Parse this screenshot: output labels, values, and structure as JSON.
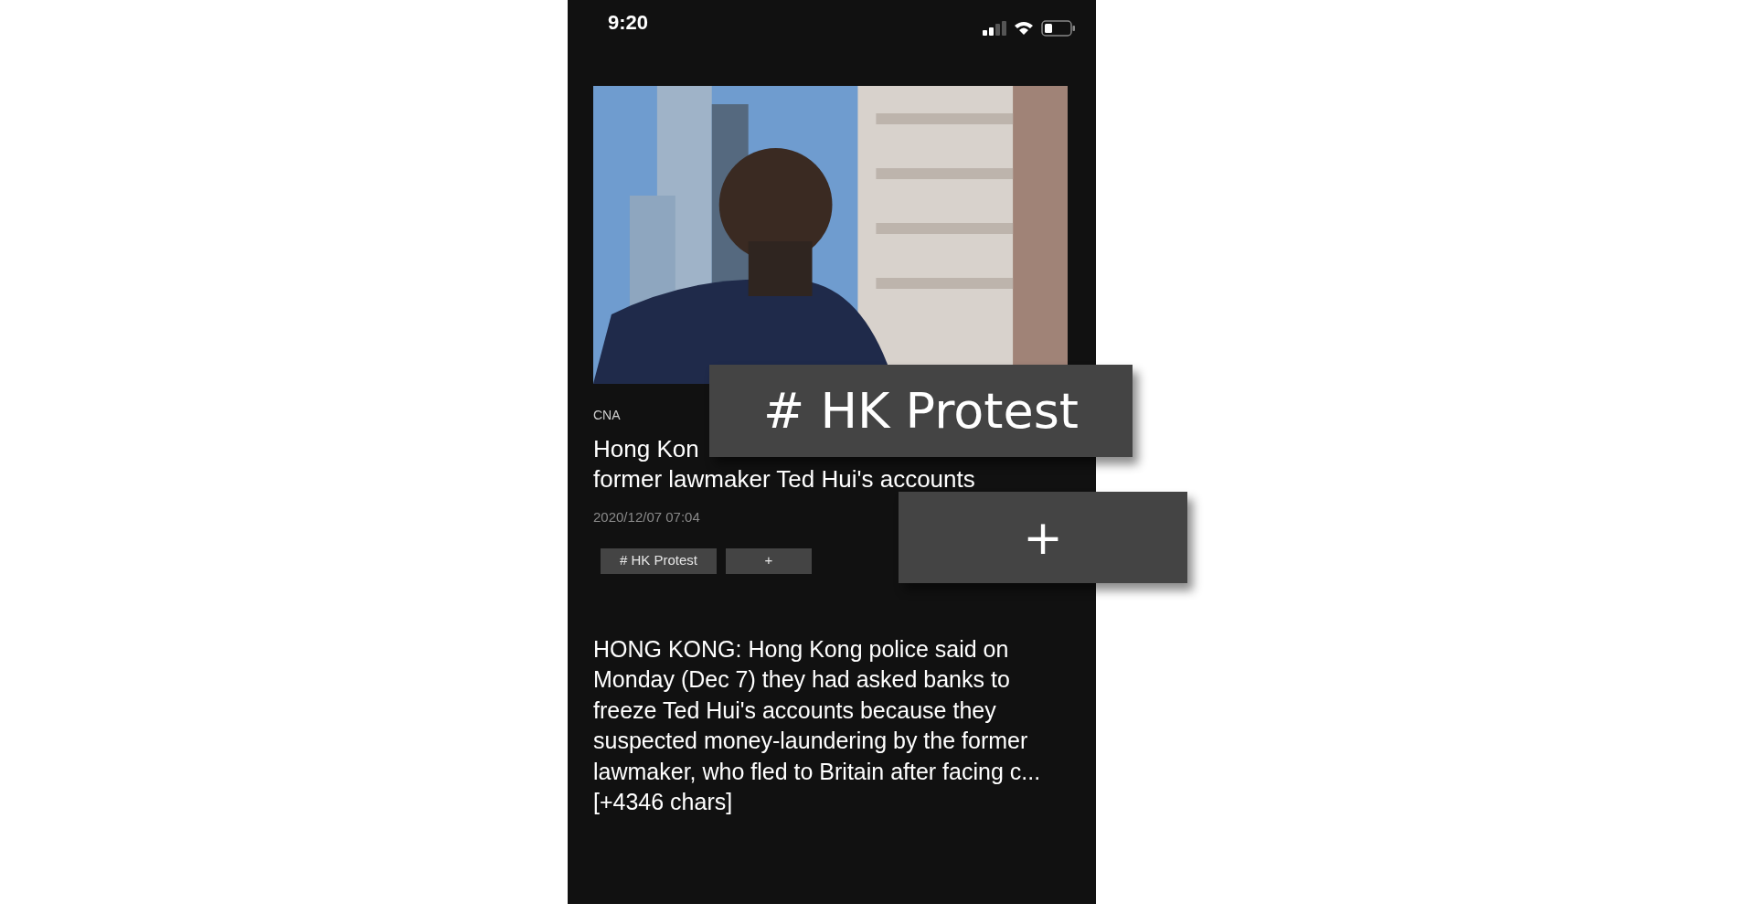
{
  "status_bar": {
    "time": "9:20"
  },
  "article": {
    "source": "CNA",
    "headline_lines": [
      "Hong Kon",
      "former lawmaker Ted Hui's accounts"
    ],
    "date": "2020/12/07 07:04",
    "tags": [
      {
        "label": "# HK Protest",
        "kind": "tag"
      },
      {
        "label": "+",
        "kind": "add"
      }
    ],
    "body": "HONG KONG: Hong Kong police said on Monday (Dec 7) they had asked banks to freeze Ted Hui's accounts because they suspected money-laundering by the former lawmaker, who fled to Britain after facing c... [+4346 chars]"
  },
  "callouts": [
    {
      "label": "# HK Protest",
      "kind": "tag"
    },
    {
      "label": "+",
      "kind": "add"
    }
  ]
}
